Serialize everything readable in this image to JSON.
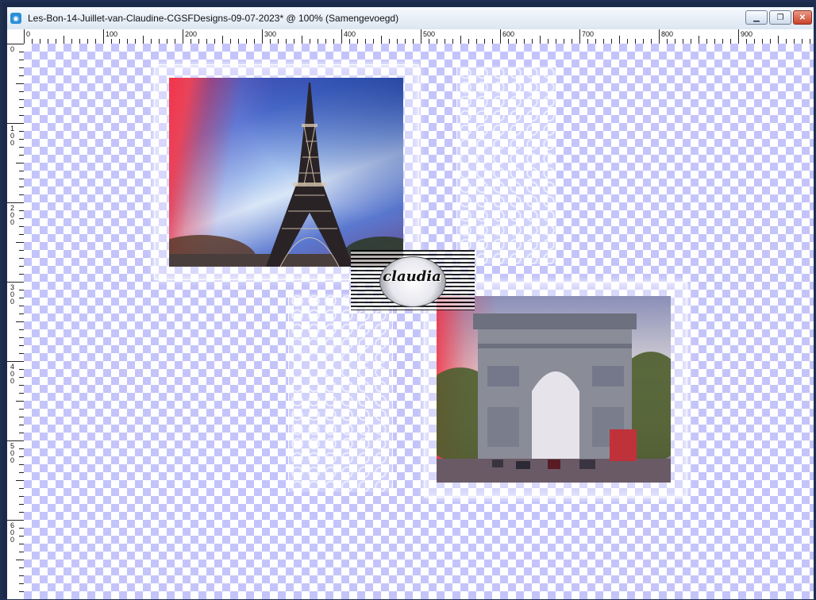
{
  "window": {
    "title": "Les-Bon-14-Juillet-van-Claudine-CGSFDesigns-09-07-2023* @ 100% (Samengevoegd)",
    "minimize": "▁",
    "maximize": "❐",
    "close": "✕"
  },
  "ruler": {
    "top_labels": [
      "0",
      "100",
      "200",
      "300",
      "400",
      "500",
      "600",
      "700",
      "800",
      "900"
    ],
    "left_labels": [
      "0",
      "100",
      "200",
      "300",
      "400",
      "500",
      "600"
    ]
  },
  "canvas": {
    "checker_color": "#c4c4fb",
    "watermark": "claudia"
  }
}
